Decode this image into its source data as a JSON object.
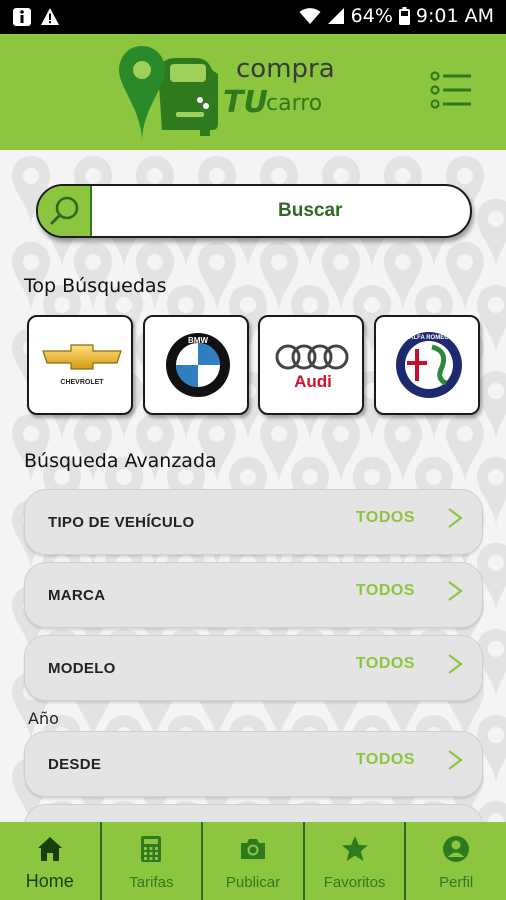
{
  "status_bar": {
    "battery": "64%",
    "time": "9:01 AM"
  },
  "header": {
    "logo_text_top": "compra",
    "logo_text_tu": "TU",
    "logo_text_carro": "carro"
  },
  "search": {
    "label": "Buscar"
  },
  "top_searches": {
    "title": "Top Búsquedas",
    "brands": [
      {
        "name": "Chevrolet",
        "logo_text": "CHEVROLET"
      },
      {
        "name": "BMW",
        "logo_text": "BMW"
      },
      {
        "name": "Audi",
        "logo_text": "Audi"
      },
      {
        "name": "Alfa Romeo",
        "logo_text": "ALFA ROMEO"
      }
    ]
  },
  "advanced_search": {
    "title": "Búsqueda Avanzada",
    "year_label": "Año",
    "filters": [
      {
        "label": "TIPO DE VEHÍCULO",
        "value": "TODOS"
      },
      {
        "label": "MARCA",
        "value": "TODOS"
      },
      {
        "label": "MODELO",
        "value": "TODOS"
      },
      {
        "label": "DESDE",
        "value": "TODOS"
      }
    ]
  },
  "bottom_nav": {
    "items": [
      {
        "label": "Home",
        "icon": "home-icon",
        "active": true
      },
      {
        "label": "Tarifas",
        "icon": "calculator-icon",
        "active": false
      },
      {
        "label": "Publicar",
        "icon": "camera-icon",
        "active": false
      },
      {
        "label": "Favoritos",
        "icon": "star-icon",
        "active": false
      },
      {
        "label": "Perfil",
        "icon": "person-icon",
        "active": false
      }
    ]
  },
  "colors": {
    "brand_green": "#8cc63f",
    "dark_green": "#2f7a1f"
  }
}
